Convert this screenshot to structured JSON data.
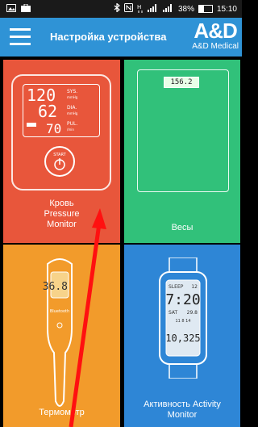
{
  "statusbar": {
    "battery_percent": "38%",
    "battery_level": 0.38,
    "time": "15:10",
    "icons": [
      "image-icon",
      "briefcase-icon",
      "bluetooth-icon",
      "nfc-icon",
      "network-h-icon",
      "signal-icon",
      "signal-icon"
    ]
  },
  "appbar": {
    "title": "Настройка устройства",
    "brand_logo": "A&D",
    "brand_sub": "A&D Medical",
    "accent": "#2f93d6"
  },
  "tiles": [
    {
      "label_lines": [
        "Кровь",
        "Pressure",
        "Monitor"
      ],
      "color": "#e8563b",
      "device": {
        "sys": "120",
        "sys_label": "SYS.",
        "sys_unit": "mmHg",
        "dia": "62",
        "dia_label": "DIA.",
        "dia_unit": "mmHg",
        "pul": "70",
        "pul_label": "PUL.",
        "pul_unit": "/min",
        "button": "START"
      }
    },
    {
      "label_lines": [
        "Весы"
      ],
      "color": "#31c17a",
      "device": {
        "display": "156.2"
      }
    },
    {
      "label_lines": [
        "Термометр"
      ],
      "color": "#f29b2b",
      "device": {
        "display": "36.8",
        "brand": "Bluetooth"
      }
    },
    {
      "label_lines": [
        "Активность Activity",
        "Monitor"
      ],
      "color": "#2e86d6",
      "device": {
        "sleep": "SLEEP",
        "sleep_num": "12",
        "time": "7:20",
        "day": "SAT",
        "date": "29.8",
        "small": "11 8 14",
        "steps": "10,325"
      }
    }
  ]
}
